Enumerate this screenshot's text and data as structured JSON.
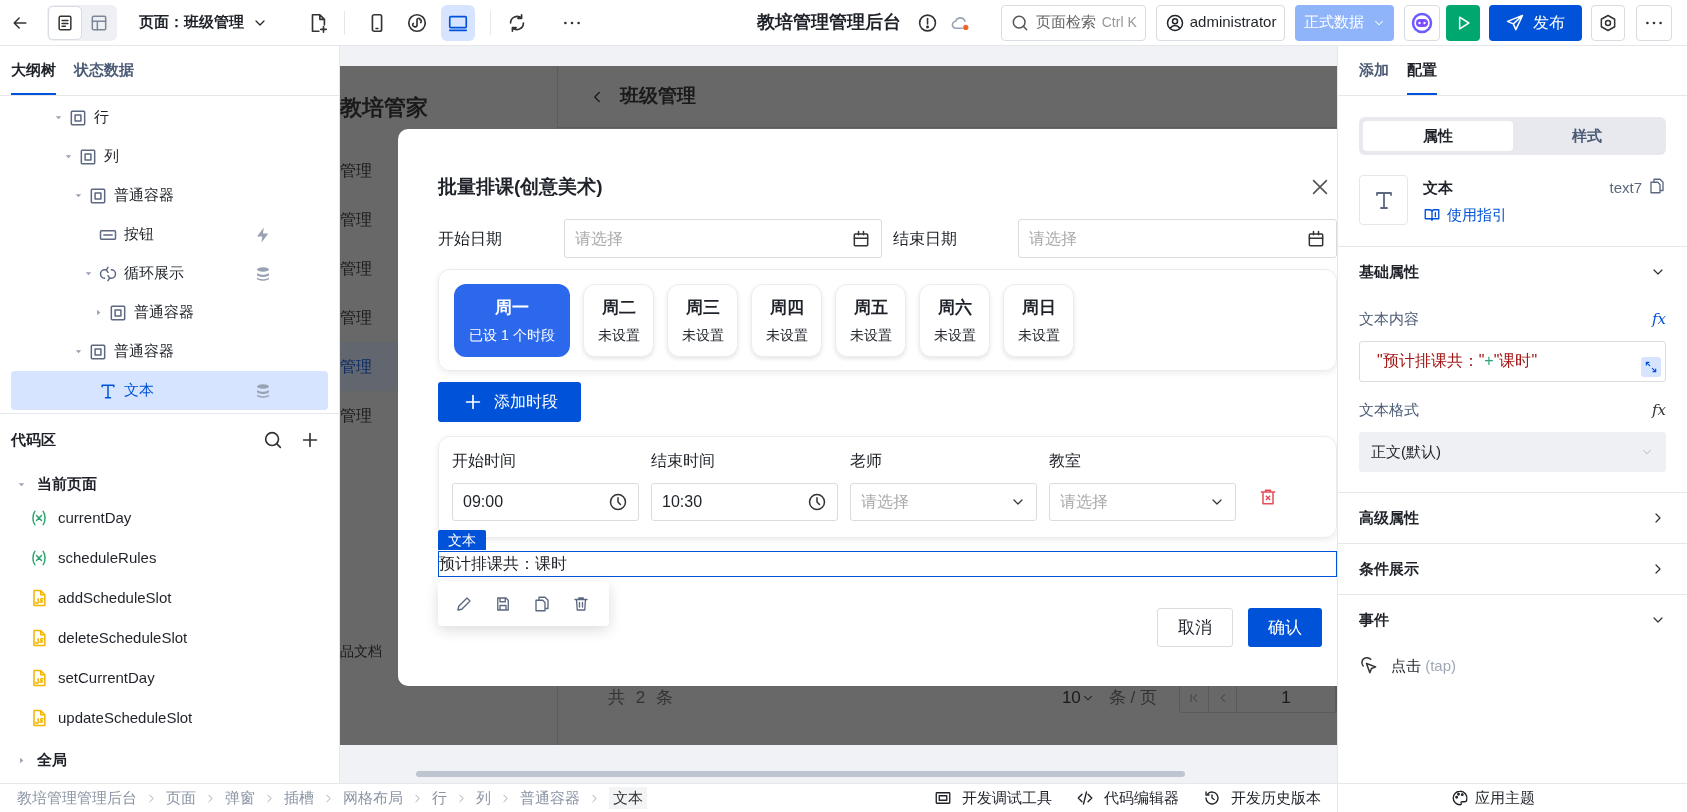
{
  "toolbar": {
    "view_modes": [
      {
        "kind": "outline",
        "selected": true
      },
      {
        "kind": "layout",
        "selected": false
      }
    ],
    "page_label": "页面：班级管理",
    "devices": [
      {
        "kind": "phone",
        "selected": false
      },
      {
        "kind": "miniapp",
        "selected": false
      },
      {
        "kind": "desktop",
        "selected": true
      }
    ],
    "app_title": "教培管理管理后台",
    "search": {
      "placeholder": "页面检索",
      "shortcut": "Ctrl K"
    },
    "user": "administrator",
    "data_source": {
      "label": "正式数据",
      "disabled": true
    },
    "publish": "发布"
  },
  "left_panel": {
    "tabs": [
      {
        "label": "大纲树",
        "selected": true
      },
      {
        "label": "状态数据",
        "selected": false
      }
    ],
    "tree": [
      {
        "label": "行",
        "kind": "container",
        "expanded": true,
        "selected": false,
        "children": [
          {
            "label": "列",
            "kind": "container",
            "expanded": true,
            "selected": false,
            "children": [
              {
                "label": "普通容器",
                "kind": "container",
                "expanded": true,
                "selected": false,
                "children": [
                  {
                    "label": "按钮",
                    "kind": "button",
                    "event_bound": true,
                    "selected": false
                  },
                  {
                    "label": "循环展示",
                    "kind": "loop",
                    "data_bound": true,
                    "expanded": true,
                    "selected": false,
                    "children": [
                      {
                        "label": "普通容器",
                        "kind": "container",
                        "expanded": false,
                        "selected": false
                      }
                    ]
                  }
                ]
              },
              {
                "label": "普通容器",
                "kind": "container",
                "expanded": true,
                "selected": false,
                "children": [
                  {
                    "label": "文本",
                    "kind": "text",
                    "data_bound": true,
                    "selected": true
                  }
                ]
              }
            ]
          }
        ]
      }
    ],
    "code_area": {
      "title": "代码区",
      "groups": [
        {
          "label": "当前页面",
          "expanded": true,
          "items": [
            {
              "kind": "variable",
              "name": "currentDay"
            },
            {
              "kind": "variable",
              "name": "scheduleRules"
            },
            {
              "kind": "function",
              "name": "addScheduleSlot"
            },
            {
              "kind": "function",
              "name": "deleteScheduleSlot"
            },
            {
              "kind": "function",
              "name": "setCurrentDay"
            },
            {
              "kind": "function",
              "name": "updateScheduleSlot"
            }
          ]
        },
        {
          "label": "全局",
          "expanded": false
        }
      ]
    }
  },
  "preview": {
    "app_name": "教培管家",
    "menu": [
      {
        "label": "管理",
        "selected": false
      },
      {
        "label": "管理",
        "selected": false
      },
      {
        "label": "管理",
        "selected": false
      },
      {
        "label": "管理",
        "selected": false
      },
      {
        "label": "管理",
        "selected": true
      },
      {
        "label": "管理",
        "selected": false
      }
    ],
    "docs_link": "品文档",
    "page_title": "班级管理",
    "total": "共 2 条",
    "page_size": "10",
    "page_size_unit": "条 / 页",
    "page_number": "1"
  },
  "dialog": {
    "title": "批量排课(创意美术)",
    "date_fields": [
      {
        "label": "开始日期",
        "placeholder": "请选择"
      },
      {
        "label": "结束日期",
        "placeholder": "请选择"
      }
    ],
    "days": [
      {
        "name": "周一",
        "status": "已设 1 个时段",
        "selected": true
      },
      {
        "name": "周二",
        "status": "未设置",
        "selected": false
      },
      {
        "name": "周三",
        "status": "未设置",
        "selected": false
      },
      {
        "name": "周四",
        "status": "未设置",
        "selected": false
      },
      {
        "name": "周五",
        "status": "未设置",
        "selected": false
      },
      {
        "name": "周六",
        "status": "未设置",
        "selected": false
      },
      {
        "name": "周日",
        "status": "未设置",
        "selected": false
      }
    ],
    "add_button": "添加时段",
    "slots": [
      {
        "fields": [
          {
            "label": "开始时间",
            "kind": "time",
            "value": "09:00"
          },
          {
            "label": "结束时间",
            "kind": "time",
            "value": "10:30"
          },
          {
            "label": "老师",
            "kind": "select",
            "placeholder": "请选择"
          },
          {
            "label": "教室",
            "kind": "select",
            "placeholder": "请选择"
          }
        ]
      }
    ],
    "selected_component": {
      "tag": "文本",
      "text": "预计排课共：课时"
    },
    "buttons": [
      {
        "label": "取消",
        "kind": "secondary"
      },
      {
        "label": "确认",
        "kind": "primary"
      }
    ]
  },
  "right_panel": {
    "tabs": [
      {
        "label": "添加",
        "selected": false
      },
      {
        "label": "配置",
        "selected": true
      }
    ],
    "segments": [
      {
        "label": "属性",
        "selected": true
      },
      {
        "label": "样式",
        "selected": false
      }
    ],
    "component": {
      "name": "文本",
      "guide_link": "使用指引",
      "id": "text7"
    },
    "sections": [
      {
        "title": "基础属性",
        "expanded": true,
        "fields": [
          {
            "kind": "expression",
            "label": "文本内容",
            "formula_mark": "fx",
            "formula_active": true,
            "tokens": [
              {
                "kind": "string",
                "text": "\"预计排课共：\""
              },
              {
                "kind": "operator",
                "text": "+"
              },
              {
                "kind": "string",
                "text": "\"课时\""
              }
            ]
          },
          {
            "kind": "select",
            "label": "文本格式",
            "formula_mark": "fx",
            "formula_active": false,
            "value": "正文(默认)"
          }
        ]
      },
      {
        "title": "高级属性",
        "expanded": false
      },
      {
        "title": "条件展示",
        "expanded": false
      },
      {
        "title": "事件",
        "expanded": true,
        "events": [
          {
            "name": "点击",
            "code": "(tap)"
          }
        ]
      }
    ],
    "theme_button": "应用主题"
  },
  "status_bar": {
    "breadcrumb": [
      "教培管理管理后台",
      "页面",
      "弹窗",
      "插槽",
      "网格布局",
      "行",
      "列",
      "普通容器",
      "文本"
    ],
    "tools": [
      {
        "kind": "debug",
        "label": "开发调试工具"
      },
      {
        "kind": "code",
        "label": "代码编辑器"
      },
      {
        "kind": "history",
        "label": "开发历史版本"
      }
    ]
  }
}
